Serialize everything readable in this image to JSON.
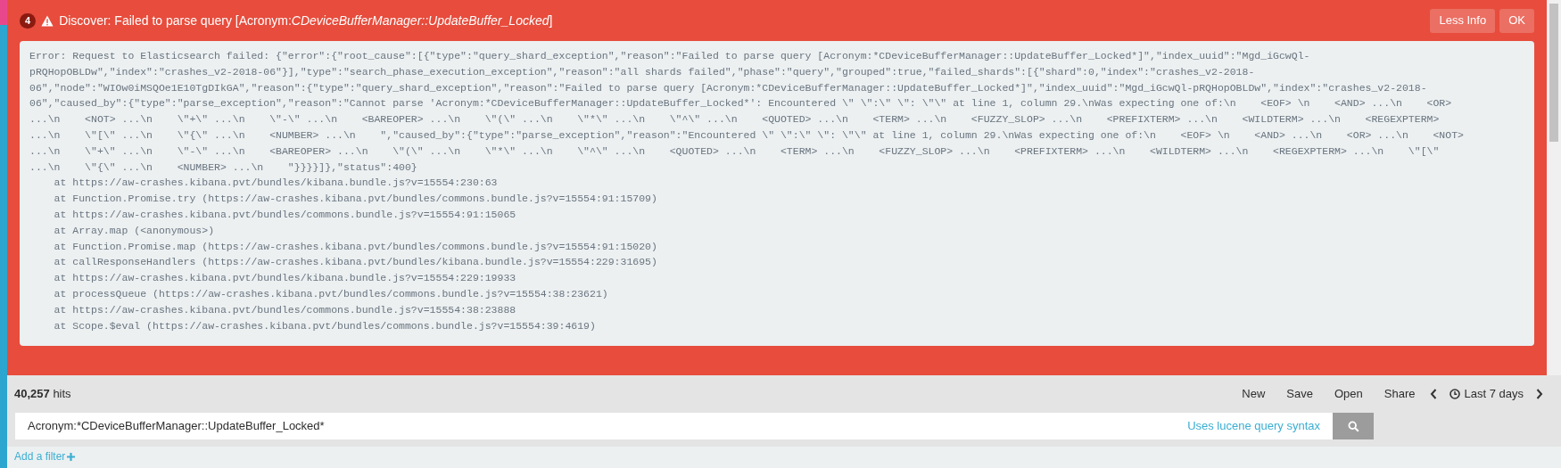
{
  "notification": {
    "count": "4",
    "title": "Discover: Failed to parse query [Acronym:*CDeviceBufferManager::UpdateBuffer_Locked*]",
    "buttons": [
      "Less Info",
      "OK"
    ],
    "details": [
      "Error: Request to Elasticsearch failed: {\"error\":{\"root_cause\":[{\"type\":\"query_shard_exception\",\"reason\":\"Failed to parse query [Acronym:*CDeviceBufferManager::UpdateBuffer_Locked*]\",\"index_uuid\":\"Mgd_iGcwQl-",
      "pRQHopOBLDw\",\"index\":\"crashes_v2-2018-06\"}],\"type\":\"search_phase_execution_exception\",\"reason\":\"all shards failed\",\"phase\":\"query\",\"grouped\":true,\"failed_shards\":[{\"shard\":0,\"index\":\"crashes_v2-2018-",
      "06\",\"node\":\"WIOw0iMSQOe1E10TgDIkGA\",\"reason\":{\"type\":\"query_shard_exception\",\"reason\":\"Failed to parse query [Acronym:*CDeviceBufferManager::UpdateBuffer_Locked*]\",\"index_uuid\":\"Mgd_iGcwQl-pRQHopOBLDw\",\"index\":\"crashes_v2-2018-",
      "06\",\"caused_by\":{\"type\":\"parse_exception\",\"reason\":\"Cannot parse 'Acronym:*CDeviceBufferManager::UpdateBuffer_Locked*': Encountered \\\" \\\":\\\" \\\": \\\"\\\" at line 1, column 29.\\nWas expecting one of:\\n    <EOF> \\n    <AND> ...\\n    <OR>",
      "...\\n    <NOT> ...\\n    \\\"+\\\" ...\\n    \\\"-\\\" ...\\n    <BAREOPER> ...\\n    \\\"(\\\" ...\\n    \\\"*\\\" ...\\n    \\\"^\\\" ...\\n    <QUOTED> ...\\n    <TERM> ...\\n    <FUZZY_SLOP> ...\\n    <PREFIXTERM> ...\\n    <WILDTERM> ...\\n    <REGEXPTERM>",
      "...\\n    \\\"[\\\" ...\\n    \\\"{\\\" ...\\n    <NUMBER> ...\\n    \",\"caused_by\":{\"type\":\"parse_exception\",\"reason\":\"Encountered \\\" \\\":\\\" \\\": \\\"\\\" at line 1, column 29.\\nWas expecting one of:\\n    <EOF> \\n    <AND> ...\\n    <OR> ...\\n    <NOT>",
      "...\\n    \\\"+\\\" ...\\n    \\\"-\\\" ...\\n    <BAREOPER> ...\\n    \\\"(\\\" ...\\n    \\\"*\\\" ...\\n    \\\"^\\\" ...\\n    <QUOTED> ...\\n    <TERM> ...\\n    <FUZZY_SLOP> ...\\n    <PREFIXTERM> ...\\n    <WILDTERM> ...\\n    <REGEXPTERM> ...\\n    \\\"[\\\"",
      "...\\n    \\\"{\\\" ...\\n    <NUMBER> ...\\n    \"}}}}]},\"status\":400}",
      "    at https://aw-crashes.kibana.pvt/bundles/kibana.bundle.js?v=15554:230:63",
      "    at Function.Promise.try (https://aw-crashes.kibana.pvt/bundles/commons.bundle.js?v=15554:91:15709)",
      "    at https://aw-crashes.kibana.pvt/bundles/commons.bundle.js?v=15554:91:15065",
      "    at Array.map (<anonymous>)",
      "    at Function.Promise.map (https://aw-crashes.kibana.pvt/bundles/commons.bundle.js?v=15554:91:15020)",
      "    at callResponseHandlers (https://aw-crashes.kibana.pvt/bundles/kibana.bundle.js?v=15554:229:31695)",
      "    at https://aw-crashes.kibana.pvt/bundles/kibana.bundle.js?v=15554:229:19933",
      "    at processQueue (https://aw-crashes.kibana.pvt/bundles/commons.bundle.js?v=15554:38:23621)",
      "    at https://aw-crashes.kibana.pvt/bundles/commons.bundle.js?v=15554:38:23888",
      "    at Scope.$eval (https://aw-crashes.kibana.pvt/bundles/commons.bundle.js?v=15554:39:4619)"
    ]
  },
  "hits": {
    "count": "40,257",
    "label": "hits"
  },
  "menu": [
    "New",
    "Save",
    "Open",
    "Share"
  ],
  "time_picker": {
    "label": "Last 7 days"
  },
  "query": {
    "value": "Acronym:*CDeviceBufferManager::UpdateBuffer_Locked*",
    "syntax_link": "Uses lucene query syntax"
  },
  "add_filter": "Add a filter"
}
